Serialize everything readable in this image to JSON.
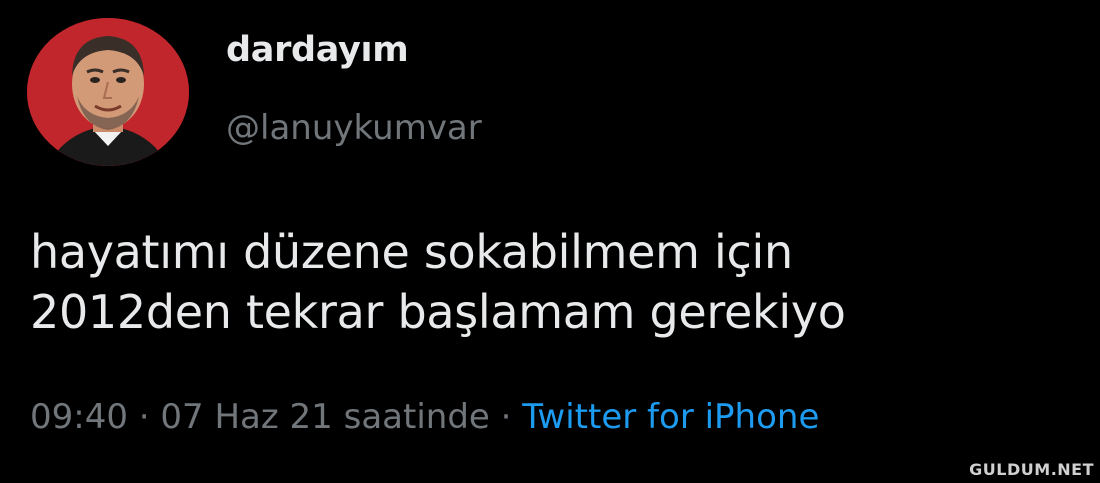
{
  "tweet": {
    "display_name": "dardayım",
    "handle": "@lanuykumvar",
    "text_lines": [
      "hayatımı düzene sokabilmem için",
      "2012den tekrar başlamam gerekiyo"
    ],
    "time": "09:40",
    "separator": "·",
    "date": "07 Haz 21 saatinde",
    "source": "Twitter for iPhone"
  },
  "watermark": "GULDUM.NET",
  "colors": {
    "background": "#000000",
    "primary_text": "#e7e9ea",
    "secondary_text": "#71767b",
    "link": "#1d9bf0",
    "avatar_bg": "#c0262b"
  },
  "icons": {
    "avatar": "profile-photo"
  }
}
